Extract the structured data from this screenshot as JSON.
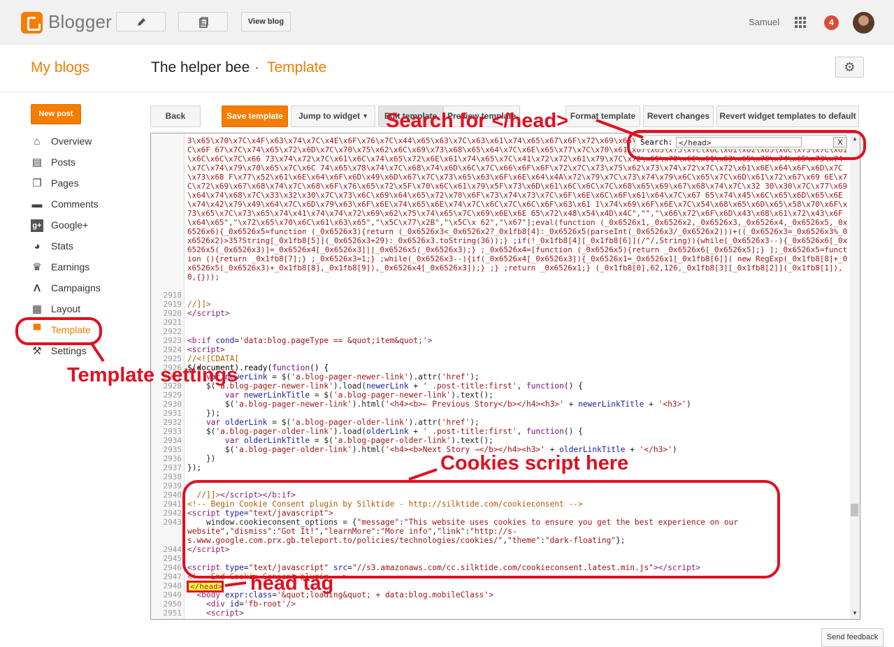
{
  "topbar": {
    "logo_text": "Blogger",
    "view_blog": "View blog",
    "user_name": "Samuel",
    "notification_count": "4"
  },
  "header": {
    "my_blogs": "My blogs",
    "blog_name": "The helper bee",
    "separator": "·",
    "page": "Template"
  },
  "sidebar": {
    "new_post": "New post",
    "items": [
      {
        "label": "Overview",
        "icon": "home-icon"
      },
      {
        "label": "Posts",
        "icon": "posts-icon"
      },
      {
        "label": "Pages",
        "icon": "pages-icon"
      },
      {
        "label": "Comments",
        "icon": "comments-icon"
      },
      {
        "label": "Google+",
        "icon": "google-plus-icon"
      },
      {
        "label": "Stats",
        "icon": "stats-icon"
      },
      {
        "label": "Earnings",
        "icon": "trophy-icon"
      },
      {
        "label": "Campaigns",
        "icon": "campaigns-icon"
      },
      {
        "label": "Layout",
        "icon": "layout-icon"
      },
      {
        "label": "Template",
        "icon": "template-icon",
        "active": true
      },
      {
        "label": "Settings",
        "icon": "wrench-icon"
      }
    ]
  },
  "toolbar": {
    "back": "Back",
    "save": "Save template",
    "jump": "Jump to widget",
    "edit": "Edit template",
    "preview": "Preview template",
    "format": "Format template",
    "revert": "Revert changes",
    "revert_widgets": "Revert widget templates to default"
  },
  "search": {
    "label": "Search:",
    "value": "</head>",
    "close": "X"
  },
  "annotations": {
    "search": "Search for </head>",
    "template_settings": "Template settings",
    "cookies": "Cookies script here",
    "head_tag": "head tag"
  },
  "head_tag_text": "</head>",
  "footer": {
    "feedback": "Send feedback"
  },
  "editor": {
    "hex_blob": "3\\x65\\x70\\x7C\\x4F\\x63\\x74\\x7C\\x4E\\x6F\\x76\\x7C\\x44\\x65\\x63\\x7C\\x63\\x61\\x74\\x65\\x67\\x6F\\x72\\x69\\x65\\x73\\x7C\\x6F\\x70\\x74\\x69\\x6F\\x6E\\x73\\x7C\\x62\\x6C\\x6F 67\\x7C\\x74\\x65\\x72\\x6D\\x7C\\x70\\x75\\x62\\x6C\\x69\\x73\\x68\\x65\\x64\\x7C\\x6E\\x65\\x77\\x7C\\x70\\x61\\x67\\x65\\x73\\x7C\\x6C\\x61\\x62\\x65\\x6C\\x73\\x7C\\x61\\x6C\\x6C\\x7C\\x66 73\\x74\\x72\\x7C\\x61\\x6C\\x74\\x65\\x72\\x6E\\x61\\x74\\x65\\x7C\\x41\\x72\\x72\\x61\\x79\\x7C\\x72\\x65\\x70\\x6C\\x61\\x63\\x65\\x7C\\x74\\x65\\x73\\x74\\x7C\\x74\\x79\\x70\\x65\\x7C\\x6C 74\\x65\\x78\\x74\\x7C\\x68\\x74\\x6D\\x6C\\x7C\\x66\\x6F\\x6F\\x72\\x7C\\x73\\x75\\x62\\x73\\x74\\x72\\x7C\\x72\\x61\\x6E\\x64\\x6F\\x6D\\x7C\\x73\\x68 F\\x77\\x52\\x61\\x6E\\x64\\x6F\\x6D\\x49\\x6D\\x67\\x7C\\x73\\x65\\x63\\x6F\\x6E\\x64\\x4A\\x72\\x79\\x7C\\x73\\x74\\x79\\x6C\\x65\\x7C\\x6D\\x61\\x72\\x67\\x69 6E\\x7C\\x72\\x69\\x67\\x68\\x74\\x7C\\x68\\x6F\\x76\\x65\\x72\\x5F\\x70\\x6C\\x61\\x79\\x5F\\x73\\x6D\\x61\\x6C\\x6C\\x7C\\x68\\x65\\x69\\x67\\x68\\x74\\x7C\\x32 30\\x30\\x7C\\x77\\x69\\x64\\x74\\x68\\x7C\\x33\\x32\\x30\\x7C\\x73\\x6C\\x69\\x64\\x65\\x72\\x70\\x6F\\x73\\x74\\x73\\x7C\\x6F\\x6E\\x6C\\x6F\\x61\\x64\\x7C\\x67 65\\x74\\x45\\x6C\\x65\\x6D\\x65\\x6E\\x74\\x42\\x79\\x49\\x64\\x7C\\x6D\\x79\\x63\\x6F\\x6E\\x74\\x65\\x6E\\x74\\x7C\\x6C\\x7C\\x6C\\x6F\\x63\\x61 1\\x74\\x69\\x6F\\x6E\\x7C\\x54\\x68\\x65\\x6D\\x65\\x58\\x70\\x6F\\x73\\x65\\x7C\\x73\\x65\\x74\\x41\\x74\\x74\\x72\\x69\\x62\\x75\\x74\\x65\\x7C\\x69\\x6E\\x6E 65\\x72\\x48\\x54\\x4D\\x4C\",\"\",\"\\x66\\x72\\x6F\\x6D\\x43\\x68\\x61\\x72\\x43\\x6F\\x64\\x65\",\"\\x72\\x65\\x70\\x6C\\x61\\x63\\x65\",\"\\x5C\\x77\\x2B\",\"\\x5C\\x 62\",\"\\x67\"];eval(function (_0x6526x1,_0x6526x2,_0x6526x3,_0x6526x4,_0x6526x5,_0x6526x6){_0x6526x5=function (_0x6526x3){return (_0x6526x3<_0x6526x2?_0x1fb8[4]:_0x6526x5(parseInt(_0x6526x3/_0x6526x2)))+((_0x6526x3=_0x6526x3%_0x6526x2)>35?String[_0x1fb8[5]](_0x6526x3+29):_0x6526x3.toString(36));} ;if(!_0x1fb8[4][_0x1fb8[6]](/^/,String)){while(_0x6526x3--){_0x6526x6[_0x6526x5(_0x6526x3)]=_0x6526x4[_0x6526x3]||_0x6526x5(_0x6526x3);} ;_0x6526x4=[function (_0x6526x5){return _0x6526x6[_0x6526x5];} ];_0x6526x5=function (){return _0x1fb8[7];} ;_0x6526x3=1;} ;while(_0x6526x3--){if(_0x6526x4[_0x6526x3]){_0x6526x1=_0x6526x1[_0x1fb8[6]]( new RegExp(_0x1fb8[8]+_0x6526x5(_0x6526x3)+_0x1fb8[8],_0x1fb8[9]),_0x6526x4[_0x6526x3]);} ;} ;return _0x6526x1;} (_0x1fb8[0],62,126,_0x1fb8[3][_0x1fb8[2]](_0x1fb8[1]),0,{}));"
  }
}
